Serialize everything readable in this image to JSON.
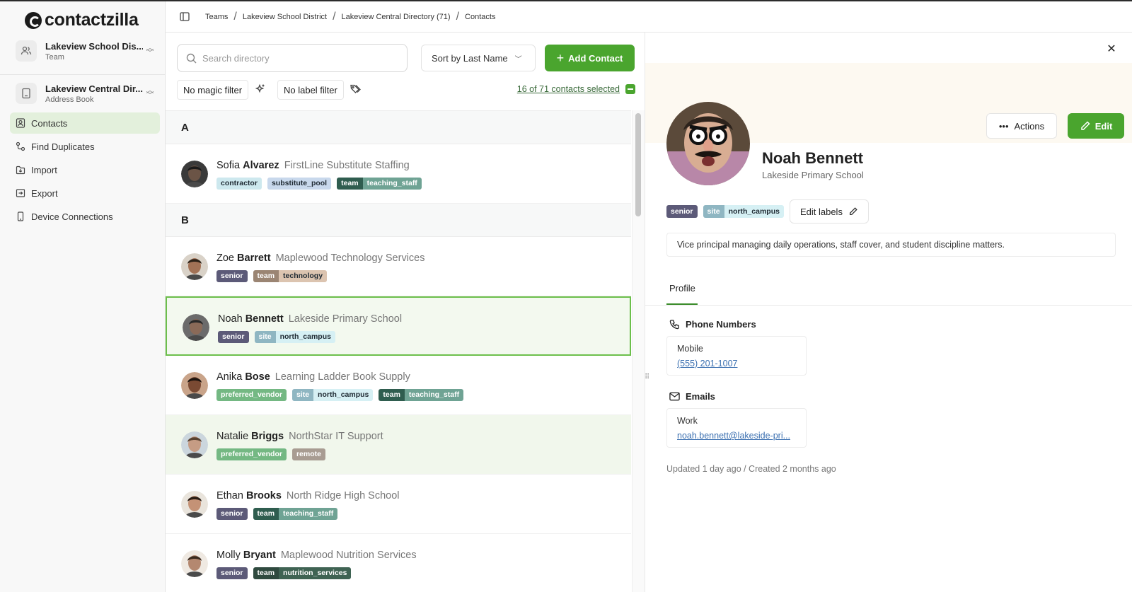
{
  "app": {
    "name": "contactzilla"
  },
  "team_switcher": {
    "title": "Lakeview School Dis...",
    "subtitle": "Team"
  },
  "book_switcher": {
    "title": "Lakeview Central Dir...",
    "subtitle": "Address Book"
  },
  "nav": [
    {
      "label": "Contacts",
      "icon": "contacts-icon",
      "active": true
    },
    {
      "label": "Find Duplicates",
      "icon": "duplicates-icon"
    },
    {
      "label": "Import",
      "icon": "import-icon"
    },
    {
      "label": "Export",
      "icon": "export-icon"
    },
    {
      "label": "Device Connections",
      "icon": "device-icon"
    }
  ],
  "breadcrumb": [
    "Teams",
    "Lakeview School District",
    "Lakeview Central Directory (71)",
    "Contacts"
  ],
  "search": {
    "placeholder": "Search directory",
    "value": ""
  },
  "sort": {
    "label": "Sort by Last Name"
  },
  "add_contact": {
    "label": "Add Contact"
  },
  "filters": {
    "magic": "No magic filter",
    "label": "No label filter",
    "selected": "16 of 71 contacts selected"
  },
  "colors": {
    "accent": "#4aa52e",
    "selected_border": "#6cbf4b"
  },
  "groups": [
    {
      "letter": "A",
      "contacts": [
        {
          "first": "Sofia",
          "last": "Alvarez",
          "org": "FirstLine Substitute Staffing",
          "tags": [
            {
              "parts": [
                "contractor"
              ],
              "colors": [
                "#cde8ee"
              ]
            },
            {
              "parts": [
                "substitute_pool"
              ],
              "colors": [
                "#c8d8ec"
              ]
            },
            {
              "parts": [
                "team",
                "teaching_staff"
              ],
              "colors": [
                "#2f5d4f",
                "#6fa394"
              ]
            }
          ]
        }
      ]
    },
    {
      "letter": "B",
      "contacts": [
        {
          "first": "Zoe",
          "last": "Barrett",
          "org": "Maplewood Technology Services",
          "tags": [
            {
              "parts": [
                "senior"
              ],
              "colors": [
                "#5c5a78"
              ]
            },
            {
              "parts": [
                "team",
                "technology"
              ],
              "colors": [
                "#9b8573",
                "#dcc4b0"
              ]
            }
          ]
        },
        {
          "first": "Noah",
          "last": "Bennett",
          "org": "Lakeside Primary School",
          "selected": true,
          "tags": [
            {
              "parts": [
                "senior"
              ],
              "colors": [
                "#5c5a78"
              ]
            },
            {
              "parts": [
                "site",
                "north_campus"
              ],
              "colors": [
                "#8fb6c2",
                "#d6f0f4"
              ]
            }
          ]
        },
        {
          "first": "Anika",
          "last": "Bose",
          "org": "Learning Ladder Book Supply",
          "tags": [
            {
              "parts": [
                "preferred_vendor"
              ],
              "colors": [
                "#74b883"
              ]
            },
            {
              "parts": [
                "site",
                "north_campus"
              ],
              "colors": [
                "#8fb6c2",
                "#d6f0f4"
              ]
            },
            {
              "parts": [
                "team",
                "teaching_staff"
              ],
              "colors": [
                "#2f5d4f",
                "#6fa394"
              ]
            }
          ]
        },
        {
          "first": "Natalie",
          "last": "Briggs",
          "org": "NorthStar IT Support",
          "hover": true,
          "tags": [
            {
              "parts": [
                "preferred_vendor"
              ],
              "colors": [
                "#74b883"
              ]
            },
            {
              "parts": [
                "remote"
              ],
              "colors": [
                "#a89c92"
              ]
            }
          ]
        },
        {
          "first": "Ethan",
          "last": "Brooks",
          "org": "North Ridge High School",
          "tags": [
            {
              "parts": [
                "senior"
              ],
              "colors": [
                "#5c5a78"
              ]
            },
            {
              "parts": [
                "team",
                "teaching_staff"
              ],
              "colors": [
                "#2f5d4f",
                "#6fa394"
              ]
            }
          ]
        },
        {
          "first": "Molly",
          "last": "Bryant",
          "org": "Maplewood Nutrition Services",
          "tags": [
            {
              "parts": [
                "senior"
              ],
              "colors": [
                "#5c5a78"
              ]
            },
            {
              "parts": [
                "team",
                "nutrition_services"
              ],
              "colors": [
                "#2f4a3f",
                "#3f6353"
              ]
            }
          ]
        }
      ]
    }
  ],
  "detail": {
    "name": "Noah Bennett",
    "org": "Lakeside Primary School",
    "actions_label": "Actions",
    "edit_label": "Edit",
    "edit_labels": "Edit labels",
    "tags": [
      {
        "parts": [
          "senior"
        ],
        "colors": [
          "#5c5a78"
        ]
      },
      {
        "parts": [
          "site",
          "north_campus"
        ],
        "colors": [
          "#8fb6c2",
          "#d6f0f4"
        ]
      }
    ],
    "note": "Vice principal managing daily operations, staff cover, and student discipline matters.",
    "tab": "Profile",
    "phones_heading": "Phone Numbers",
    "phone": {
      "label": "Mobile",
      "value": "(555) 201-1007"
    },
    "emails_heading": "Emails",
    "email": {
      "label": "Work",
      "value": "noah.bennett@lakeside-pri..."
    },
    "meta": "Updated 1 day ago  /  Created 2 months ago"
  }
}
